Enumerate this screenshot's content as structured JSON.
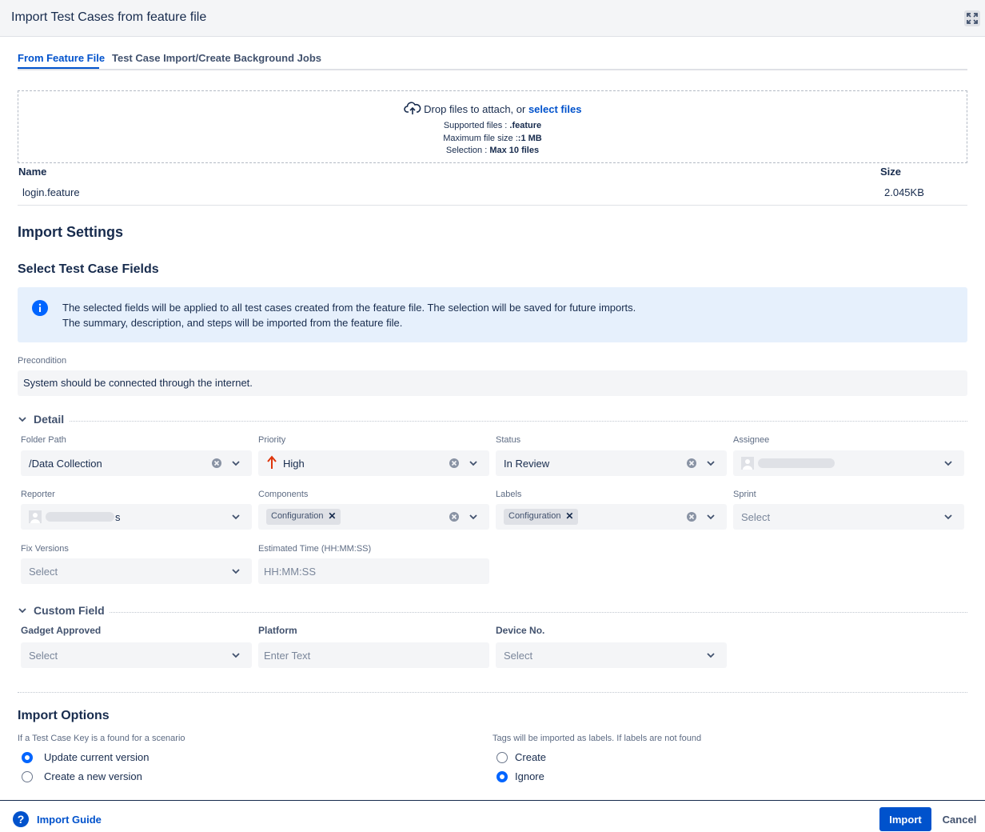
{
  "dialog": {
    "title": "Import Test Cases from feature file"
  },
  "tabs": [
    {
      "label": "From Feature File",
      "active": true
    },
    {
      "label": "Test Case Import/Create Background Jobs",
      "active": false
    }
  ],
  "dropzone": {
    "prompt": "Drop files to attach, or",
    "link": "select files",
    "supported_label": "Supported files :",
    "supported_value": ".feature",
    "max_size_label": "Maximum file size :",
    "max_size_value": ":1 MB",
    "selection_label": "Selection :",
    "selection_value": "Max 10 files"
  },
  "files": {
    "columns": [
      "Name",
      "Size"
    ],
    "rows": [
      {
        "name": "login.feature",
        "size": "2.045KB"
      }
    ]
  },
  "import_settings": {
    "title": "Import Settings",
    "fields_title": "Select Test Case Fields",
    "info_line1": "The selected fields will be applied to all test cases created from the feature file. The selection will be saved for future imports.",
    "info_line2": "The summary, description, and steps will be imported from the feature file.",
    "precondition_label": "Precondition",
    "precondition_value": "System should be connected through the internet."
  },
  "detail": {
    "title": "Detail",
    "folder_path": {
      "label": "Folder Path",
      "value": "/Data Collection"
    },
    "priority": {
      "label": "Priority",
      "value": "High"
    },
    "status": {
      "label": "Status",
      "value": "In Review"
    },
    "assignee": {
      "label": "Assignee"
    },
    "reporter": {
      "label": "Reporter",
      "suffix": "s"
    },
    "components": {
      "label": "Components",
      "chip": "Configuration"
    },
    "labels": {
      "label": "Labels",
      "chip": "Configuration"
    },
    "sprint": {
      "label": "Sprint",
      "placeholder": "Select"
    },
    "fix_versions": {
      "label": "Fix Versions",
      "placeholder": "Select"
    },
    "estimated_time": {
      "label": "Estimated Time (HH:MM:SS)",
      "placeholder": "HH:MM:SS"
    }
  },
  "custom_field": {
    "title": "Custom Field",
    "gadget_approved": {
      "label": "Gadget Approved",
      "placeholder": "Select"
    },
    "platform": {
      "label": "Platform",
      "placeholder": "Enter Text"
    },
    "device_no": {
      "label": "Device No.",
      "placeholder": "Select"
    }
  },
  "import_options": {
    "title": "Import Options",
    "key_question": "If a Test Case Key is a found for a scenario",
    "key_options": [
      {
        "label": "Update current version",
        "selected": true
      },
      {
        "label": "Create a new version",
        "selected": false
      }
    ],
    "tags_question": "Tags will be imported as labels. If labels are not found",
    "tags_options": [
      {
        "label": "Create",
        "selected": false
      },
      {
        "label": "Ignore",
        "selected": true
      }
    ]
  },
  "footer": {
    "guide": "Import Guide",
    "guide_icon": "?",
    "import_button": "Import",
    "cancel_button": "Cancel"
  },
  "colors": {
    "primary": "#0052cc",
    "radio_on": "#0065ff",
    "priority_high": "#de350b",
    "info_bg": "#e6f0fc"
  }
}
